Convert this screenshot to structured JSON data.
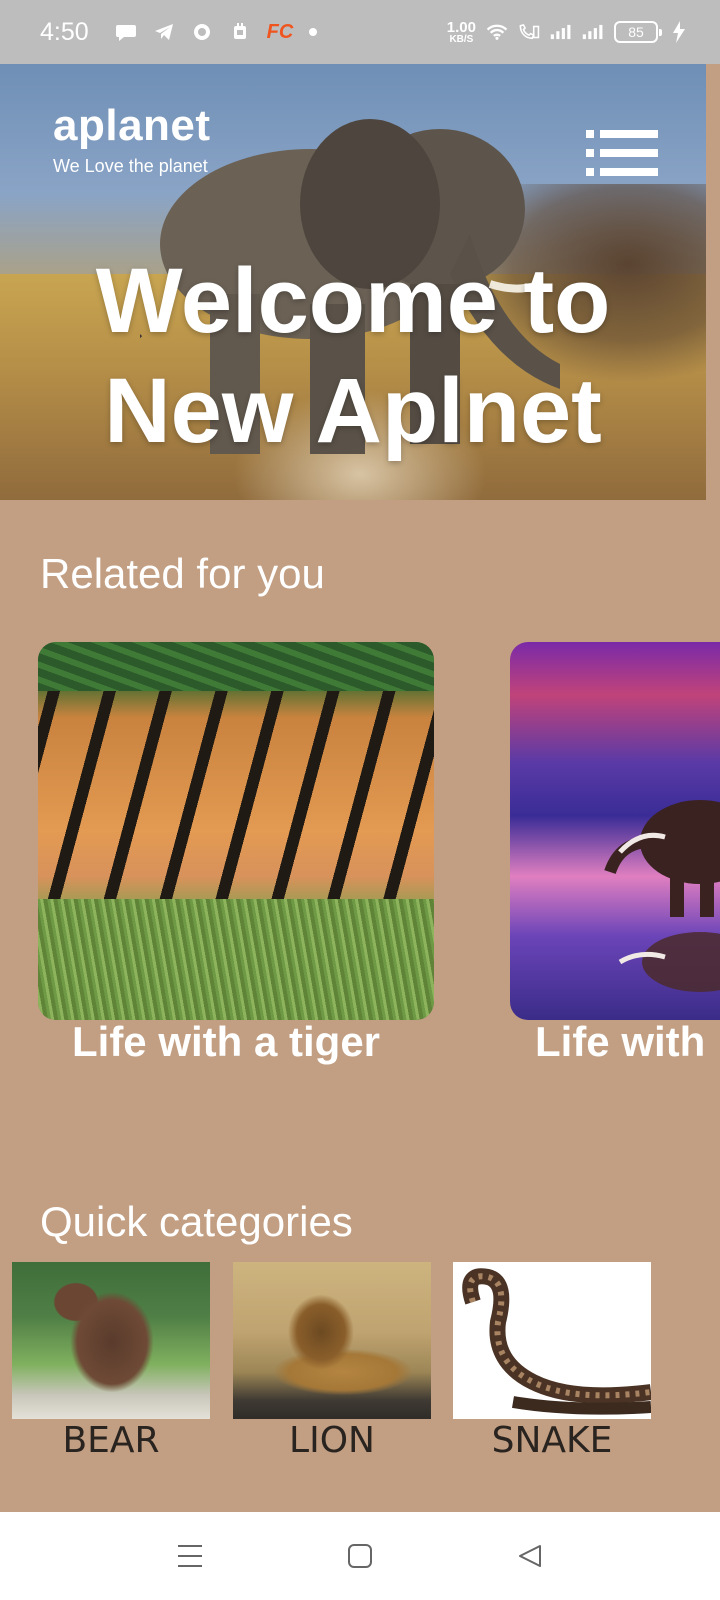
{
  "status_bar": {
    "time": "4:50",
    "fc_label": "FC",
    "speed_value": "1.00",
    "speed_unit": "KB/S",
    "battery": "85",
    "icons": [
      "chat-icon",
      "telegram-icon",
      "app-icon",
      "sim-icon",
      "fc-app-icon",
      "dot-icon",
      "wifi-icon",
      "volte-icon",
      "signal-1-icon",
      "signal-2-icon",
      "battery-icon",
      "charging-icon"
    ]
  },
  "header": {
    "logo_title": "aplanet",
    "logo_subtitle": "We Love the planet",
    "menu_icon": "hamburger-menu-icon",
    "hero_line1": "Welcome to",
    "hero_line2": "New Aplnet"
  },
  "related": {
    "title": "Related for you",
    "cards": [
      {
        "caption": "Life with a tiger"
      },
      {
        "caption": "Life with"
      }
    ]
  },
  "categories": {
    "title": "Quick categories",
    "items": [
      {
        "label": "BEAR"
      },
      {
        "label": "LION"
      },
      {
        "label": "SNAKE"
      }
    ]
  },
  "nav_bar": {
    "icons": [
      "recent-apps-icon",
      "home-icon",
      "back-icon"
    ]
  },
  "colors": {
    "background": "#c29e82",
    "status_bar": "#bdbdbd",
    "fc_accent": "#f0551f",
    "nav_bar": "#ffffff"
  }
}
